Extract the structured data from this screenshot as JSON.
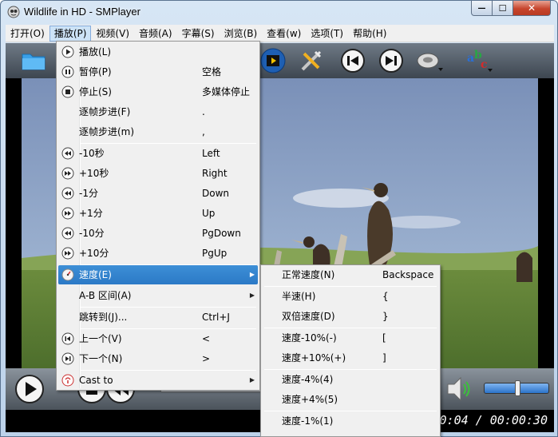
{
  "window": {
    "title": "Wildlife in HD - SMPlayer",
    "minimize_glyph": "—",
    "maximize_glyph": "☐",
    "close_glyph": "✕"
  },
  "menubar": {
    "items": [
      {
        "label": "打开(O)"
      },
      {
        "label": "播放(P)"
      },
      {
        "label": "视频(V)"
      },
      {
        "label": "音频(A)"
      },
      {
        "label": "字幕(S)"
      },
      {
        "label": "浏览(B)"
      },
      {
        "label": "查看(w)"
      },
      {
        "label": "选项(T)"
      },
      {
        "label": "帮助(H)"
      }
    ]
  },
  "toolbar": {
    "icons": [
      "open-folder-icon",
      "video-clip-icon",
      "tools-icon",
      "previous-icon",
      "next-icon",
      "audio-icon",
      "subtitle-icon"
    ]
  },
  "play_menu": {
    "items": [
      {
        "label": "播放(L)",
        "shortcut": "",
        "icon": "play-icon"
      },
      {
        "label": "暂停(P)",
        "shortcut": "空格",
        "icon": "pause-icon"
      },
      {
        "label": "停止(S)",
        "shortcut": "多媒体停止",
        "icon": "stop-icon"
      },
      {
        "label": "逐帧步进(F)",
        "shortcut": ".",
        "icon": ""
      },
      {
        "label": "逐帧步进(m)",
        "shortcut": ",",
        "icon": ""
      },
      {
        "label": "-10秒",
        "shortcut": "Left",
        "icon": "rewind-icon"
      },
      {
        "label": "+10秒",
        "shortcut": "Right",
        "icon": "forward-icon"
      },
      {
        "label": "-1分",
        "shortcut": "Down",
        "icon": "rewind-icon"
      },
      {
        "label": "+1分",
        "shortcut": "Up",
        "icon": "forward-icon"
      },
      {
        "label": "-10分",
        "shortcut": "PgDown",
        "icon": "rewind-icon"
      },
      {
        "label": "+10分",
        "shortcut": "PgUp",
        "icon": "forward-icon"
      },
      {
        "label": "速度(E)",
        "shortcut": "",
        "icon": "speed-icon",
        "submenu": true
      },
      {
        "label": "A-B 区间(A)",
        "shortcut": "",
        "icon": "",
        "submenu": true
      },
      {
        "label": "跳转到(J)...",
        "shortcut": "Ctrl+J",
        "icon": ""
      },
      {
        "label": "上一个(V)",
        "shortcut": "<",
        "icon": "previous-icon"
      },
      {
        "label": "下一个(N)",
        "shortcut": ">",
        "icon": "next-icon"
      },
      {
        "label": "Cast to",
        "shortcut": "",
        "icon": "cast-icon",
        "submenu": true
      }
    ]
  },
  "speed_menu": {
    "items": [
      {
        "label": "正常速度(N)",
        "shortcut": "Backspace"
      },
      {
        "label": "半速(H)",
        "shortcut": "{"
      },
      {
        "label": "双倍速度(D)",
        "shortcut": "}"
      },
      {
        "label": "速度-10%(-)",
        "shortcut": "["
      },
      {
        "label": "速度+10%(+)",
        "shortcut": "]"
      },
      {
        "label": "速度-4%(4)",
        "shortcut": ""
      },
      {
        "label": "速度+4%(5)",
        "shortcut": ""
      },
      {
        "label": "速度-1%(1)",
        "shortcut": ""
      }
    ]
  },
  "status": {
    "time": "00:00:04 / 00:00:30"
  },
  "colors": {
    "highlight": "#2b79c6",
    "toolbar": "#4b535b"
  }
}
